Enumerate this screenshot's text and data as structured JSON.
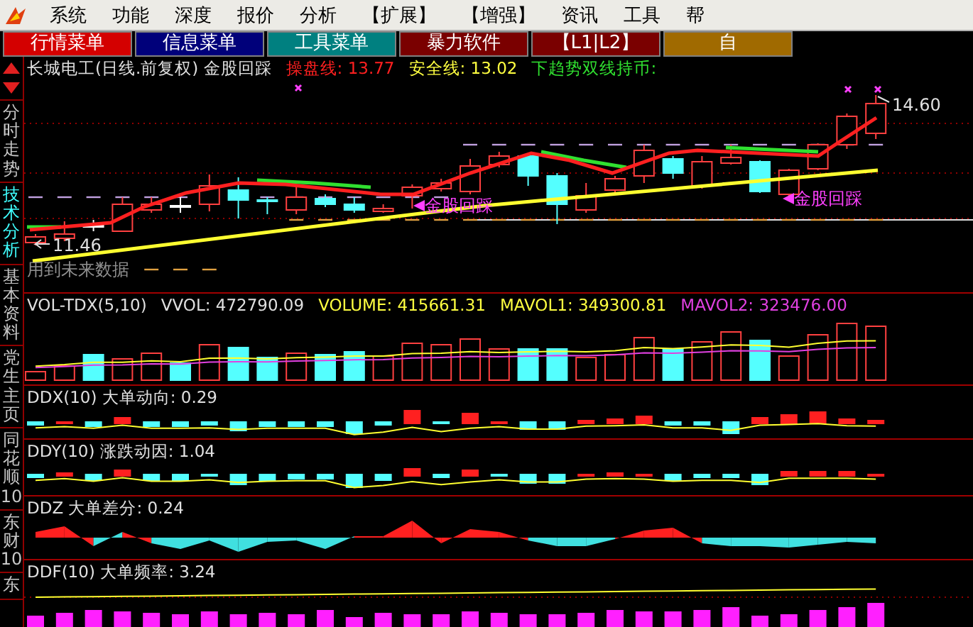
{
  "menu_bar": {
    "items": [
      "系统",
      "功能",
      "深度",
      "报价",
      "分析",
      "【扩展】",
      "【增强】",
      "资讯",
      "工具",
      "帮"
    ]
  },
  "toolbar_tabs": [
    {
      "label": "行情菜单",
      "color": "#d40000"
    },
    {
      "label": "信息菜单",
      "color": "#00007a"
    },
    {
      "label": "工具菜单",
      "color": "#008080"
    },
    {
      "label": "暴力软件",
      "color": "#7a0000"
    },
    {
      "label": "【L1|L2】",
      "color": "#7a0000"
    },
    {
      "label": "自",
      "color": "#a06a00"
    }
  ],
  "side_tabs": [
    {
      "label": "分时走势",
      "selected": false
    },
    {
      "label": "技术分析",
      "selected": true
    },
    {
      "label": "基本资料",
      "selected": false
    },
    {
      "label": "党生主页",
      "selected": false
    },
    {
      "label": "同花顺10",
      "selected": false
    },
    {
      "label": "东财10",
      "selected": false
    },
    {
      "label": "东",
      "selected": false
    }
  ],
  "price_panel": {
    "title": "长城电工(日线.前复权) 金股回踩",
    "indicators": [
      {
        "text": "操盘线: 13.77",
        "color": "#ff2020"
      },
      {
        "text": "安全线: 13.02",
        "color": "#ffff40"
      },
      {
        "text": "下趋势双线持币:",
        "color": "#30e030"
      }
    ],
    "high_label": "14.60",
    "low_label": "11.46",
    "signal_labels": [
      "金股回踩",
      "金股回踩"
    ],
    "note": "用到未来数据"
  },
  "indicator_panels": [
    {
      "kind": "volume",
      "items": [
        {
          "text": "VOL-TDX(5,10)",
          "color": "#e0e0e0"
        },
        {
          "text": "VVOL: 472790.09",
          "color": "#e0e0e0"
        },
        {
          "text": "VOLUME: 415661.31",
          "color": "#ffff40"
        },
        {
          "text": "MAVOL1: 349300.81",
          "color": "#ffff40"
        },
        {
          "text": "MAVOL2: 323476.00",
          "color": "#e040e0"
        }
      ]
    },
    {
      "kind": "bars",
      "items": [
        {
          "text": "DDX(10) 大单动向: 0.29",
          "color": "#e0e0e0"
        }
      ]
    },
    {
      "kind": "bars",
      "items": [
        {
          "text": "DDY(10) 涨跌动因: 1.04",
          "color": "#e0e0e0"
        }
      ]
    },
    {
      "kind": "area",
      "items": [
        {
          "text": "DDZ 大单差分: 0.24",
          "color": "#e0e0e0"
        }
      ]
    },
    {
      "kind": "frequency",
      "items": [
        {
          "text": "DDF(10) 大单频率: 3.24",
          "color": "#e0e0e0"
        }
      ]
    }
  ]
}
